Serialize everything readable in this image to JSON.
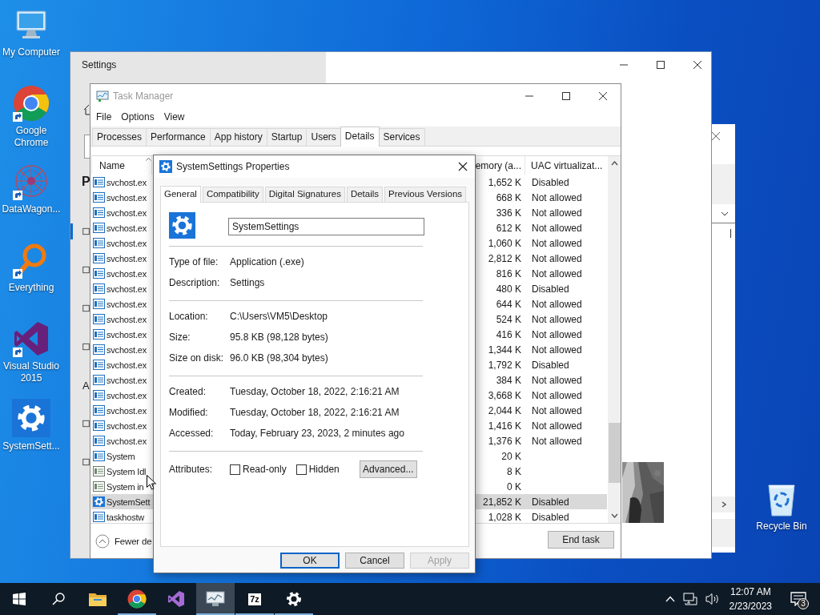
{
  "desktop_icons": [
    {
      "kind": "computer",
      "label": "My Computer",
      "shortcut": false
    },
    {
      "kind": "browser",
      "label": "Google Chrome",
      "shortcut": true
    },
    {
      "kind": "mesh",
      "label": "DataWagon...",
      "shortcut": true
    },
    {
      "kind": "magnifier",
      "label": "Everything",
      "shortcut": true
    },
    {
      "kind": "loop",
      "label": "Visual Studio 2015",
      "shortcut": true
    },
    {
      "kind": "gear",
      "label": "SystemSett...",
      "shortcut": false
    }
  ],
  "recycle_bin": {
    "label": "Recycle Bin"
  },
  "settings_window": {
    "title": "Settings",
    "heading": "P",
    "nav_items": [
      {
        "selected": true
      },
      {
        "selected": false
      },
      {
        "selected": false
      },
      {
        "selected": false
      },
      {
        "selected": false,
        "letter": "A"
      },
      {
        "selected": false
      },
      {
        "selected": false
      }
    ]
  },
  "task_manager": {
    "title": "Task Manager",
    "menu": [
      "File",
      "Options",
      "View"
    ],
    "tabs": [
      {
        "label": "Processes",
        "selected": false
      },
      {
        "label": "Performance",
        "selected": false
      },
      {
        "label": "App history",
        "selected": false
      },
      {
        "label": "Startup",
        "selected": false
      },
      {
        "label": "Users",
        "selected": false
      },
      {
        "label": "Details",
        "selected": true
      },
      {
        "label": "Services",
        "selected": false
      }
    ],
    "columns": [
      "Name",
      "emory (a...",
      "UAC virtualizat..."
    ],
    "rows": [
      {
        "kind": "app",
        "name": "svchost.ex",
        "memory": "1,652 K",
        "uac": "Disabled",
        "selected": false
      },
      {
        "kind": "app",
        "name": "svchost.ex",
        "memory": "668 K",
        "uac": "Not allowed",
        "selected": false
      },
      {
        "kind": "app",
        "name": "svchost.ex",
        "memory": "336 K",
        "uac": "Not allowed",
        "selected": false
      },
      {
        "kind": "app",
        "name": "svchost.ex",
        "memory": "612 K",
        "uac": "Not allowed",
        "selected": false
      },
      {
        "kind": "app",
        "name": "svchost.ex",
        "memory": "1,060 K",
        "uac": "Not allowed",
        "selected": false
      },
      {
        "kind": "app",
        "name": "svchost.ex",
        "memory": "2,812 K",
        "uac": "Not allowed",
        "selected": false
      },
      {
        "kind": "app",
        "name": "svchost.ex",
        "memory": "816 K",
        "uac": "Not allowed",
        "selected": false
      },
      {
        "kind": "app",
        "name": "svchost.ex",
        "memory": "480 K",
        "uac": "Disabled",
        "selected": false
      },
      {
        "kind": "app",
        "name": "svchost.ex",
        "memory": "644 K",
        "uac": "Not allowed",
        "selected": false
      },
      {
        "kind": "app",
        "name": "svchost.ex",
        "memory": "524 K",
        "uac": "Not allowed",
        "selected": false
      },
      {
        "kind": "app",
        "name": "svchost.ex",
        "memory": "416 K",
        "uac": "Not allowed",
        "selected": false
      },
      {
        "kind": "app",
        "name": "svchost.ex",
        "memory": "1,344 K",
        "uac": "Not allowed",
        "selected": false
      },
      {
        "kind": "app",
        "name": "svchost.ex",
        "memory": "1,792 K",
        "uac": "Disabled",
        "selected": false
      },
      {
        "kind": "app",
        "name": "svchost.ex",
        "memory": "384 K",
        "uac": "Not allowed",
        "selected": false
      },
      {
        "kind": "app",
        "name": "svchost.ex",
        "memory": "3,668 K",
        "uac": "Not allowed",
        "selected": false
      },
      {
        "kind": "app",
        "name": "svchost.ex",
        "memory": "2,044 K",
        "uac": "Not allowed",
        "selected": false
      },
      {
        "kind": "app",
        "name": "svchost.ex",
        "memory": "1,416 K",
        "uac": "Not allowed",
        "selected": false
      },
      {
        "kind": "app",
        "name": "svchost.ex",
        "memory": "1,376 K",
        "uac": "Not allowed",
        "selected": false
      },
      {
        "kind": "app",
        "name": "System",
        "memory": "20 K",
        "selected": false
      },
      {
        "kind": "system",
        "name": "System Idl",
        "memory": "8 K",
        "selected": false
      },
      {
        "kind": "system",
        "name": "System in",
        "memory": "0 K",
        "selected": false
      },
      {
        "kind": "gear",
        "name": "SystemSett",
        "memory": "21,852 K",
        "uac": "Disabled",
        "selected": true
      },
      {
        "kind": "app",
        "name": "taskhostw",
        "memory": "1,028 K",
        "uac": "Disabled",
        "selected": false
      }
    ],
    "footer_link": "Fewer de",
    "end_task": "End task"
  },
  "properties_dialog": {
    "title": "SystemSettings Properties",
    "tabs": [
      {
        "label": "General",
        "selected": true
      },
      {
        "label": "Compatibility",
        "selected": false
      },
      {
        "label": "Digital Signatures",
        "selected": false
      },
      {
        "label": "Details",
        "selected": false
      },
      {
        "label": "Previous Versions",
        "selected": false
      }
    ],
    "file_name": "SystemSettings",
    "groups": [
      [
        {
          "label": "Type of file:",
          "value": "Application (.exe)"
        },
        {
          "label": "Description:",
          "value": "Settings"
        }
      ],
      [
        {
          "label": "Location:",
          "value": "C:\\Users\\VM5\\Desktop"
        },
        {
          "label": "Size:",
          "value": "95.8 KB (98,128 bytes)"
        },
        {
          "label": "Size on disk:",
          "value": "96.0 KB (98,304 bytes)"
        }
      ],
      [
        {
          "label": "Created:",
          "value": "Tuesday, October 18, 2022, 2:16:21 AM"
        },
        {
          "label": "Modified:",
          "value": "Tuesday, October 18, 2022, 2:16:21 AM"
        },
        {
          "label": "Accessed:",
          "value": "Today, February 23, 2023, 2 minutes ago"
        }
      ]
    ],
    "attributes": {
      "label": "Attributes:",
      "checkboxes": [
        {
          "label": "Read-only",
          "checked": false
        },
        {
          "label": "Hidden",
          "checked": false
        }
      ],
      "advanced": "Advanced..."
    },
    "buttons": [
      {
        "label": "OK",
        "default": true,
        "disabled": false
      },
      {
        "label": "Cancel",
        "default": false,
        "disabled": false
      },
      {
        "label": "Apply",
        "default": false,
        "disabled": true
      }
    ]
  },
  "taskbar": {
    "apps": [
      {
        "kind": "folder",
        "running": false,
        "active": false
      },
      {
        "kind": "browser",
        "running": true,
        "active": false
      },
      {
        "kind": "loop",
        "running": false,
        "active": false
      },
      {
        "kind": "monitor",
        "running": true,
        "active": true
      },
      {
        "kind": "archiver",
        "text": "7z",
        "running": true,
        "active": false
      },
      {
        "kind": "gear",
        "running": true,
        "active": false
      }
    ],
    "time": "12:07 AM",
    "date": "2/23/2023",
    "notification_count": "3"
  }
}
